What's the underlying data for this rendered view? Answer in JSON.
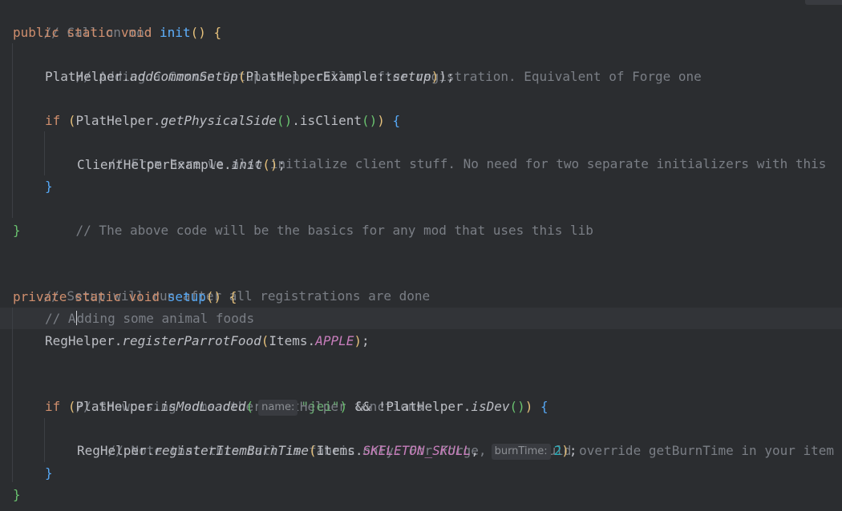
{
  "editor": {
    "lines": [
      {
        "comment": "// Call on mod init"
      },
      {
        "kw1": "public",
        "kw2": "static",
        "kw3": "void",
        "fn": "init",
        "open": "() {"
      },
      {
        "comment": "// Adding a Common Setup step, called after registration. Equivalent of Forge one"
      },
      {
        "cls": "PlatHelper",
        "method": "addCommonSetup",
        "arg_cls": "PlatHelperExample",
        "arg_method": "setup",
        "end": ");"
      },
      {
        "empty": ""
      },
      {
        "kw": "if",
        "cls": "PlatHelper",
        "method": "getPhysicalSide",
        "call": "isClient",
        "end": "{"
      },
      {
        "comment": "// From here we also initialize client stuff. No need for two separate initializers with this"
      },
      {
        "cls": "ClientHelperExample",
        "method": "init",
        "end": ";"
      },
      {
        "close": "}"
      },
      {
        "comment": "// The above code will be the basics for any mod that uses this lib"
      },
      {
        "close": "}"
      },
      {
        "empty": ""
      },
      {
        "comment": "// Setup will run after all registrations are done"
      },
      {
        "kw1": "private",
        "kw2": "static",
        "kw3": "void",
        "fn": "setup",
        "open": "() {"
      },
      {
        "comment_before_caret": "// A",
        "comment_after_caret": "dding some animal foods"
      },
      {
        "cls": "RegHelper",
        "method": "registerParrotFood",
        "arg_cls": "Items",
        "const": "APPLE",
        "end": ";"
      },
      {
        "empty": ""
      },
      {
        "comment": "// Showcasing some other PlatHelper functions"
      },
      {
        "kw": "if",
        "cls": "PlatHelper",
        "method": "isModLoaded",
        "hint": "name:",
        "str": "\"jei\"",
        "op": "&& !",
        "cls2": "PlatHelper",
        "method2": "isDev",
        "end": "{"
      },
      {
        "comment": "// Note that this call is fabric only. For Forge, you should override getBurnTime in your item"
      },
      {
        "cls": "RegHelper",
        "method": "registerItemBurnTime",
        "arg_cls": "Items",
        "const": "SKELETON_SKULL",
        "hint": "burnTime:",
        "num": "2",
        "end": ";"
      },
      {
        "close": "}"
      },
      {
        "close": "}"
      }
    ]
  },
  "colors": {
    "background": "#2b2d30",
    "caret_line": "#323438",
    "comment": "#7a7e85",
    "keyword": "#cf8e6d",
    "function_decl": "#56a8f5",
    "constant": "#c77dbb",
    "string": "#6aab73",
    "number": "#2aacb8"
  }
}
